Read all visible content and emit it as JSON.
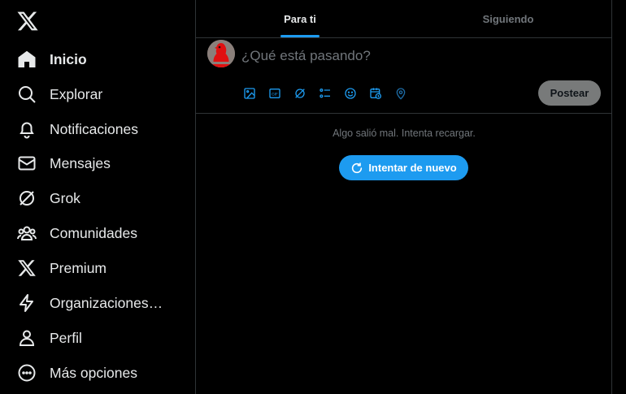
{
  "sidebar": {
    "logo": "x-logo-icon",
    "items": [
      {
        "label": "Inicio",
        "icon": "home-icon",
        "active": true
      },
      {
        "label": "Explorar",
        "icon": "search-icon"
      },
      {
        "label": "Notificaciones",
        "icon": "bell-icon"
      },
      {
        "label": "Mensajes",
        "icon": "envelope-icon"
      },
      {
        "label": "Grok",
        "icon": "grok-icon"
      },
      {
        "label": "Comunidades",
        "icon": "people-icon"
      },
      {
        "label": "Premium",
        "icon": "x-icon"
      },
      {
        "label": "Organizaciones v...",
        "icon": "lightning-icon"
      },
      {
        "label": "Perfil",
        "icon": "user-icon"
      },
      {
        "label": "Más opciones",
        "icon": "more-circle-icon"
      }
    ]
  },
  "tabs": [
    {
      "label": "Para ti",
      "active": true
    },
    {
      "label": "Siguiendo",
      "active": false
    }
  ],
  "composer": {
    "placeholder": "¿Qué está pasando?",
    "post_label": "Postear",
    "tools": [
      "image-icon",
      "gif-icon",
      "grok-icon",
      "poll-icon",
      "emoji-icon",
      "schedule-icon",
      "location-icon"
    ]
  },
  "feed": {
    "error_text": "Algo salió mal. Intenta recargar.",
    "retry_label": "Intentar de nuevo"
  },
  "colors": {
    "accent": "#1d9bf0",
    "background": "#000000",
    "border": "#2f3336",
    "text_primary": "#e7e9ea",
    "text_secondary": "#71767b"
  }
}
